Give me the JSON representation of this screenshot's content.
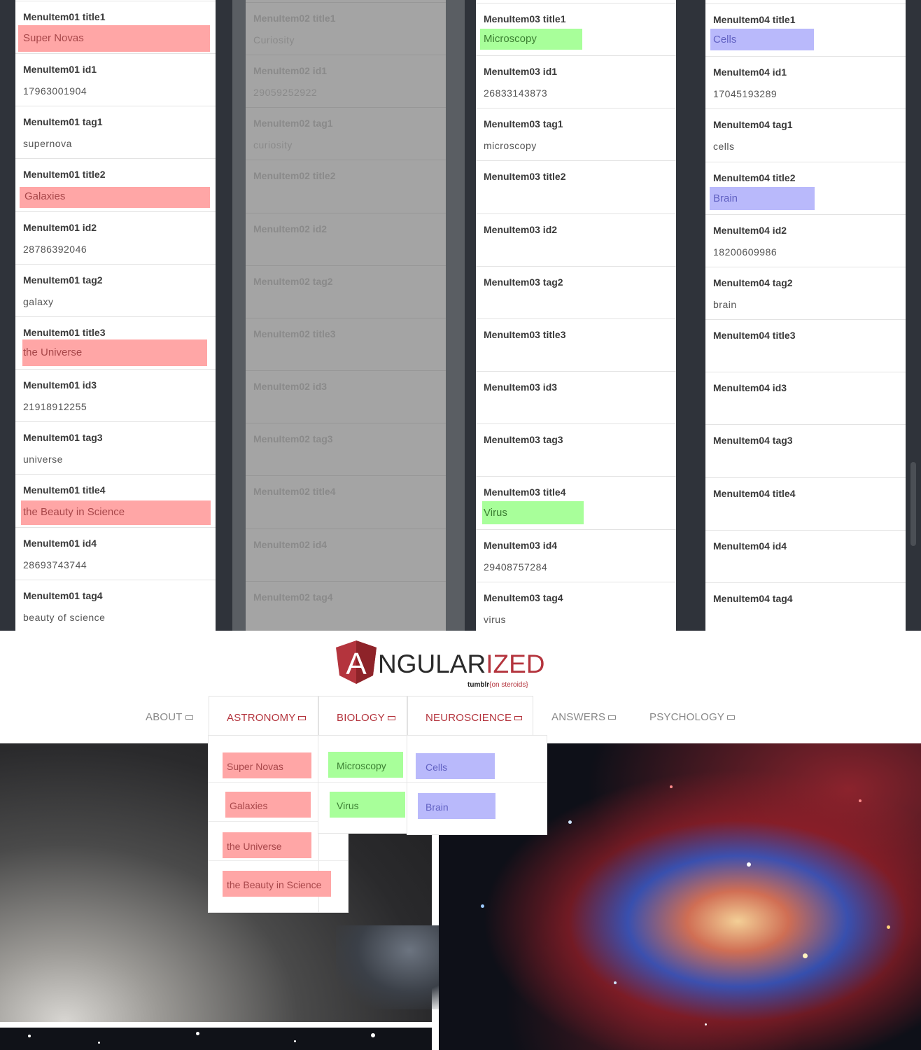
{
  "columns": [
    {
      "fields": [
        {
          "label": "MenuItem01 title1",
          "value": "Super Novas",
          "style": "chip"
        },
        {
          "label": "MenuItem01 id1",
          "value": "17963001904"
        },
        {
          "label": "MenuItem01 tag1",
          "value": "supernova"
        },
        {
          "label": "MenuItem01 title2",
          "value": "Galaxies",
          "style": "chip"
        },
        {
          "label": "MenuItem01 id2",
          "value": "28786392046"
        },
        {
          "label": "MenuItem01 tag2",
          "value": "galaxy"
        },
        {
          "label": "MenuItem01 title3",
          "value": "the Universe",
          "style": "chip"
        },
        {
          "label": "MenuItem01 id3",
          "value": "21918912255"
        },
        {
          "label": "MenuItem01 tag3",
          "value": "universe"
        },
        {
          "label": "MenuItem01 title4",
          "value": "the Beauty in Science",
          "style": "chip"
        },
        {
          "label": "MenuItem01 id4",
          "value": "28693743744"
        },
        {
          "label": "MenuItem01 tag4",
          "value": "beauty of science"
        }
      ]
    },
    {
      "fields": [
        {
          "label": "MenuItem02 title1",
          "value": "Curiosity"
        },
        {
          "label": "MenuItem02 id1",
          "value": "29059252922"
        },
        {
          "label": "MenuItem02 tag1",
          "value": "curiosity"
        },
        {
          "label": "MenuItem02 title2",
          "value": ""
        },
        {
          "label": "MenuItem02 id2",
          "value": ""
        },
        {
          "label": "MenuItem02 tag2",
          "value": ""
        },
        {
          "label": "MenuItem02 title3",
          "value": ""
        },
        {
          "label": "MenuItem02 id3",
          "value": ""
        },
        {
          "label": "MenuItem02 tag3",
          "value": ""
        },
        {
          "label": "MenuItem02 title4",
          "value": ""
        },
        {
          "label": "MenuItem02 id4",
          "value": ""
        },
        {
          "label": "MenuItem02 tag4",
          "value": ""
        }
      ]
    },
    {
      "fields": [
        {
          "label": "MenuItem03 title1",
          "value": "Microscopy",
          "style": "chip"
        },
        {
          "label": "MenuItem03 id1",
          "value": "26833143873"
        },
        {
          "label": "MenuItem03 tag1",
          "value": "microscopy"
        },
        {
          "label": "MenuItem03 title2",
          "value": ""
        },
        {
          "label": "MenuItem03 id2",
          "value": ""
        },
        {
          "label": "MenuItem03 tag2",
          "value": ""
        },
        {
          "label": "MenuItem03 title3",
          "value": ""
        },
        {
          "label": "MenuItem03 id3",
          "value": ""
        },
        {
          "label": "MenuItem03 tag3",
          "value": ""
        },
        {
          "label": "MenuItem03 title4",
          "value": "Virus",
          "style": "chip"
        },
        {
          "label": "MenuItem03 id4",
          "value": "29408757284"
        },
        {
          "label": "MenuItem03 tag4",
          "value": "virus"
        }
      ]
    },
    {
      "fields": [
        {
          "label": "MenuItem04 title1",
          "value": "Cells",
          "style": "chip"
        },
        {
          "label": "MenuItem04 id1",
          "value": "17045193289"
        },
        {
          "label": "MenuItem04 tag1",
          "value": "cells"
        },
        {
          "label": "MenuItem04 title2",
          "value": "Brain",
          "style": "chip"
        },
        {
          "label": "MenuItem04 id2",
          "value": "18200609986"
        },
        {
          "label": "MenuItem04 tag2",
          "value": "brain"
        },
        {
          "label": "MenuItem04 title3",
          "value": ""
        },
        {
          "label": "MenuItem04 id3",
          "value": ""
        },
        {
          "label": "MenuItem04 tag3",
          "value": ""
        },
        {
          "label": "MenuItem04 title4",
          "value": ""
        },
        {
          "label": "MenuItem04 id4",
          "value": ""
        },
        {
          "label": "MenuItem04 tag4",
          "value": ""
        }
      ]
    }
  ],
  "logo": {
    "letter": "A",
    "word_main": "NGULAR",
    "word_accent": "IZED",
    "sub_main": "tumblr",
    "sub_accent": "{on steroids}"
  },
  "nav": [
    {
      "label": "ABOUT"
    },
    {
      "label": "ASTRONOMY"
    },
    {
      "label": "BIOLOGY"
    },
    {
      "label": "NEUROSCIENCE"
    },
    {
      "label": "ANSWERS"
    },
    {
      "label": "PSYCHOLOGY"
    }
  ],
  "dropdowns": {
    "astronomy": [
      "Super Novas",
      "Galaxies",
      "the Universe",
      "the Beauty in Science"
    ],
    "biology": [
      "Microscopy",
      "Virus"
    ],
    "neuroscience": [
      "Cells",
      "Brain"
    ]
  },
  "colors": {
    "accent": "#b4343d",
    "astronomy_chip": "#ffa6a6",
    "biology_chip": "#a8ff9a",
    "neuroscience_chip": "#b9b9fb"
  },
  "icons": {
    "nav_toggle": "minus-box-icon",
    "logo": "angular-shield-icon"
  }
}
